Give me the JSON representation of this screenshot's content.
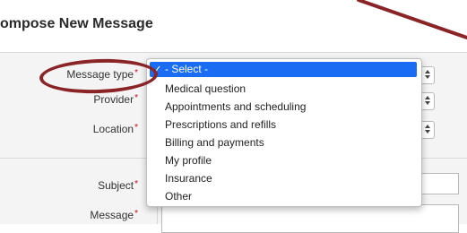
{
  "header": {
    "title": "ompose New Message"
  },
  "form": {
    "message_type_label": "Message type",
    "provider_label": "Provider",
    "location_label": "Location",
    "subject_label": "Subject",
    "message_label": "Message",
    "required_mark": "*"
  },
  "message_type_select": {
    "selected": "- Select -",
    "options": [
      "Medical question",
      "Appointments and scheduling",
      "Prescriptions and refills",
      "Billing and payments",
      "My profile",
      "Insurance",
      "Other"
    ],
    "check_glyph": "✓"
  },
  "colors": {
    "selection": "#1a6cf2",
    "annotation": "#8a2426",
    "required": "#d0021b"
  }
}
